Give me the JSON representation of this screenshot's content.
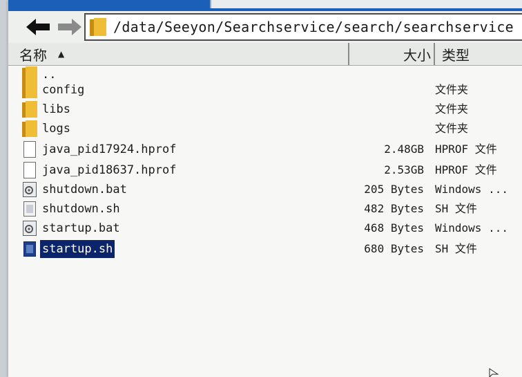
{
  "address": {
    "path": "/data/Seeyon/Searchservice/search/searchservice"
  },
  "columns": {
    "name": "名称",
    "size": "大小",
    "type": "类型"
  },
  "files": [
    {
      "name": "..",
      "size": "",
      "type": "",
      "icon": "folder-icon"
    },
    {
      "name": "config",
      "size": "",
      "type": "文件夹",
      "icon": "folder-icon"
    },
    {
      "name": "libs",
      "size": "",
      "type": "文件夹",
      "icon": "folder-icon"
    },
    {
      "name": "logs",
      "size": "",
      "type": "文件夹",
      "icon": "folder-icon"
    },
    {
      "name": "java_pid17924.hprof",
      "size": "2.48GB",
      "type": "HPROF 文件",
      "icon": "file-icon"
    },
    {
      "name": "java_pid18637.hprof",
      "size": "2.53GB",
      "type": "HPROF 文件",
      "icon": "file-icon"
    },
    {
      "name": "shutdown.bat",
      "size": "205 Bytes",
      "type": "Windows ...",
      "icon": "batch-file-icon"
    },
    {
      "name": "shutdown.sh",
      "size": "482 Bytes",
      "type": "SH 文件",
      "icon": "script-file-icon"
    },
    {
      "name": "startup.bat",
      "size": "468 Bytes",
      "type": "Windows ...",
      "icon": "batch-file-icon"
    },
    {
      "name": "startup.sh",
      "size": "680 Bytes",
      "type": "SH 文件",
      "icon": "script-file-icon",
      "selected": true
    }
  ],
  "colors": {
    "titlebar": "#1b5fb8",
    "selection": "#0c246a",
    "folder": "#e8b530"
  }
}
